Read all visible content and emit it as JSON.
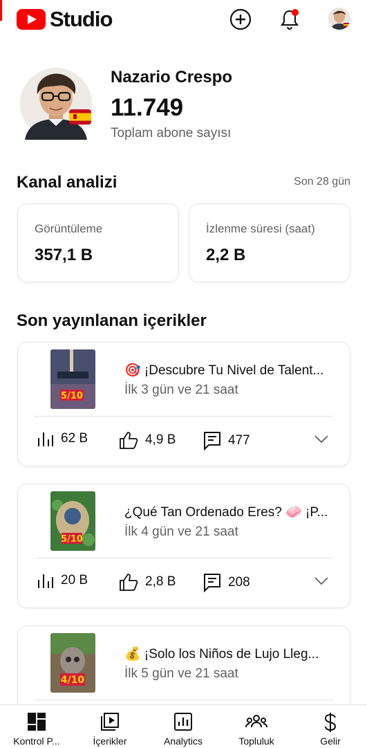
{
  "app": {
    "logo_text": "Studio"
  },
  "topbar": {
    "create_icon": "create-plus-icon",
    "notifications_icon": "bell-icon",
    "account_icon": "avatar"
  },
  "channel": {
    "name": "Nazario Crespo",
    "subscriber_count": "11.749",
    "subscriber_label": "Toplam abone sayısı"
  },
  "analytics": {
    "title": "Kanal analizi",
    "period": "Son 28 gün",
    "cards": [
      {
        "label": "Görüntüleme",
        "value": "357,1 B"
      },
      {
        "label": "İzlenme süresi (saat)",
        "value": "2,2 B"
      }
    ]
  },
  "recent": {
    "title": "Son yayınlanan içerikler",
    "videos": [
      {
        "title": "🎯 ¡Descubre Tu Nivel de Talent...",
        "age": "İlk 3 gün ve 21 saat",
        "views": "62 B",
        "likes": "4,9 B",
        "comments": "477"
      },
      {
        "title": "¿Qué Tan Ordenado Eres? 🧼 ¡P...",
        "age": "İlk 4 gün ve 21 saat",
        "views": "20 B",
        "likes": "2,8 B",
        "comments": "208"
      },
      {
        "title": "💰 ¡Solo los Niños de Lujo Lleg...",
        "age": "İlk 5 gün ve 21 saat",
        "views": "",
        "likes": "",
        "comments": ""
      }
    ]
  },
  "nav": {
    "items": [
      {
        "label": "Kontrol P...",
        "icon": "dashboard-icon"
      },
      {
        "label": "İçerikler",
        "icon": "content-icon"
      },
      {
        "label": "Analytics",
        "icon": "analytics-icon"
      },
      {
        "label": "Topluluk",
        "icon": "community-icon"
      },
      {
        "label": "Gelir",
        "icon": "dollar-icon"
      }
    ]
  },
  "colors": {
    "brand_red": "#ff0000",
    "text": "#0f0f0f",
    "secondary_text": "#606060"
  }
}
